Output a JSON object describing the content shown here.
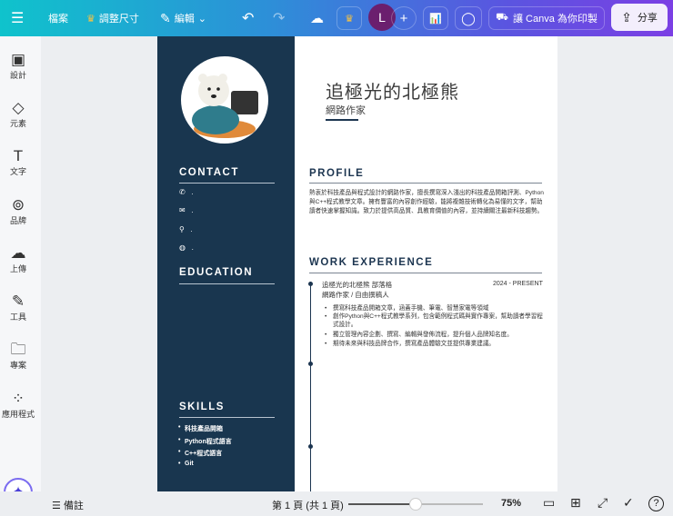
{
  "toolbar": {
    "file": "檔案",
    "resize": "調整尺寸",
    "edit": "編輯",
    "print": "讓 Canva 為你印製",
    "share": "分享",
    "avatar": "L"
  },
  "sidebar": [
    {
      "label": "設計",
      "icon": "layout-icon"
    },
    {
      "label": "元素",
      "icon": "shapes-icon"
    },
    {
      "label": "文字",
      "icon": "text-icon"
    },
    {
      "label": "品牌",
      "icon": "brand-icon"
    },
    {
      "label": "上傳",
      "icon": "upload-icon"
    },
    {
      "label": "工具",
      "icon": "pen-icon"
    },
    {
      "label": "專案",
      "icon": "folder-icon"
    },
    {
      "label": "應用程式",
      "icon": "apps-icon"
    }
  ],
  "resume": {
    "name": "追極光的北極熊",
    "title": "網路作家",
    "contact_heading": "CONTACT",
    "contact_values": [
      ".",
      ".",
      ".",
      "."
    ],
    "education_heading": "EDUCATION",
    "skills_heading": "SKILLS",
    "skills": [
      "科技產品開箱",
      "Python程式語言",
      "C++程式語言",
      "Git"
    ],
    "profile_heading": "PROFILE",
    "profile_text": "熱衷於科技產品與程式設計的網路作家，擅長撰寫深入淺出的科技產品開箱評測、Python與C++程式教學文章。擁有豐富的內容創作經驗，能將複雜技術轉化為易懂的文字，幫助讀者快速掌握知識。致力於提供高品質、具教育價值的內容，並持續關注最新科技趨勢。",
    "work_heading": "WORK EXPERIENCE",
    "job": {
      "org": "追極光的北極熊 部落格",
      "dates": "2024 - PRESENT",
      "role": "網路作家 / 自由撰稿人",
      "bullets": [
        "撰寫科技產品開箱文章，涵蓋手機、筆電、智慧家電等領域",
        "創作Python與C++程式教學系列，包含範例程式碼與實作專案，幫助讀者學習程式設計。",
        "獨立管理內容企劃、撰寫、編輯與發佈流程，提升個人品牌知名度。",
        "期待未來與科技品牌合作，撰寫產品體驗文並提供專業建議。"
      ]
    }
  },
  "footer": {
    "notes": "備註",
    "page": "第 1 頁 (共 1 頁)",
    "zoom": "75%",
    "zoom_slider_fraction": 0.5
  }
}
